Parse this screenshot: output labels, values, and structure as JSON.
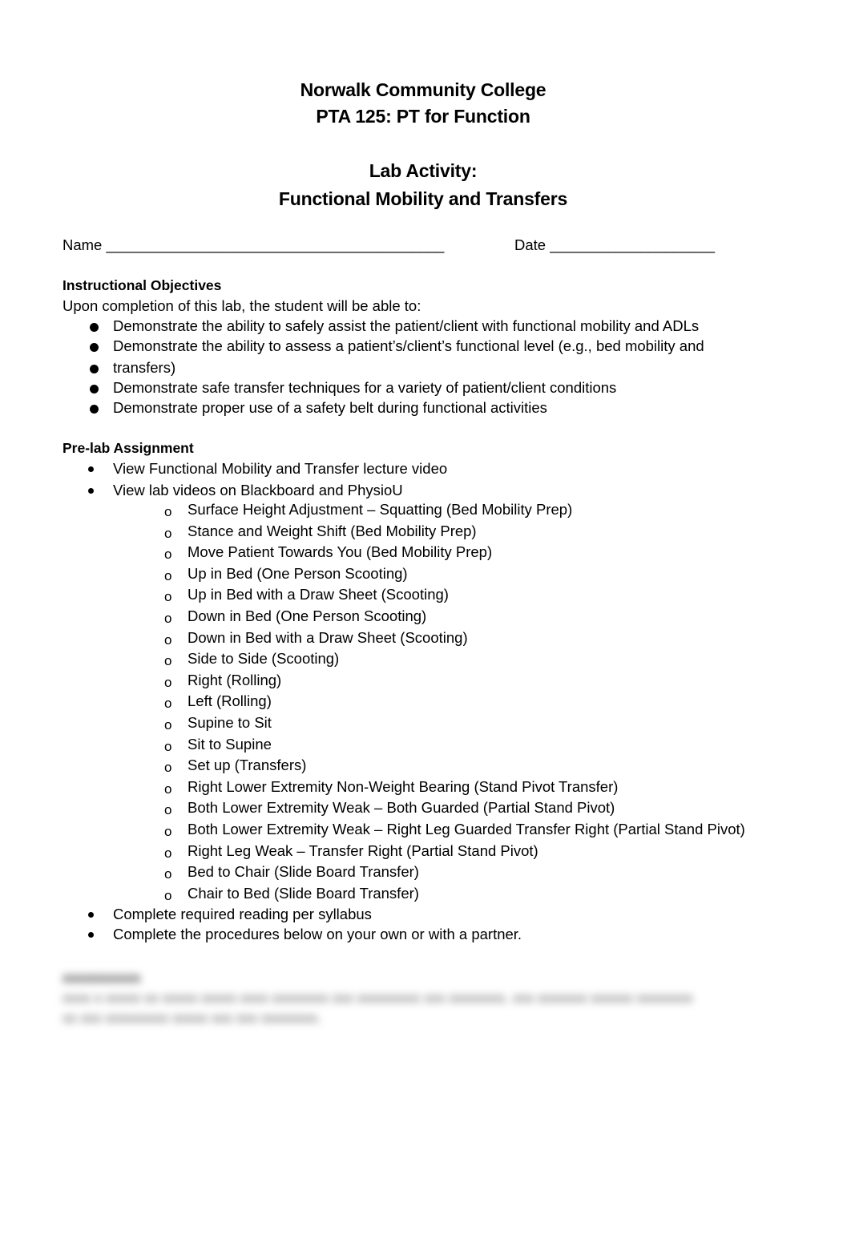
{
  "header": {
    "institution": "Norwalk Community College",
    "course": "PTA 125: PT for Function",
    "activity_label": "Lab Activity:",
    "activity_title": "Functional Mobility and Transfers"
  },
  "form": {
    "name_label": "Name _________________________________________",
    "date_label": "Date ____________________"
  },
  "objectives": {
    "heading": "Instructional Objectives",
    "intro": "Upon completion of this lab, the student will be able to:",
    "items": [
      "Demonstrate the ability to safely assist the patient/client with functional mobility and ADLs",
      "Demonstrate the ability to assess a patient’s/client’s functional level (e.g., bed mobility and",
      "transfers)",
      "Demonstrate safe transfer techniques for a variety of patient/client conditions",
      "Demonstrate proper use of a safety belt during functional activities"
    ]
  },
  "prelab": {
    "heading": "Pre-lab Assignment",
    "items": [
      "View Functional Mobility and Transfer lecture video",
      "View lab videos on Blackboard and PhysioU"
    ],
    "sub_bullet_glyph": "o",
    "videos": [
      "Surface Height Adjustment – Squatting (Bed Mobility Prep)",
      "Stance and Weight Shift (Bed Mobility Prep)",
      "Move Patient Towards You (Bed Mobility Prep)",
      "Up in Bed (One Person Scooting)",
      "Up in Bed with a Draw Sheet (Scooting)",
      "Down in Bed (One Person Scooting)",
      "Down in Bed with a Draw Sheet (Scooting)",
      "Side to Side (Scooting)",
      "Right (Rolling)",
      "Left (Rolling)",
      "Supine to Sit",
      "Sit to Supine",
      "Set up (Transfers)",
      "Right Lower Extremity Non-Weight Bearing (Stand Pivot Transfer)",
      "Both Lower Extremity Weak – Both Guarded (Partial Stand Pivot)",
      "Both Lower Extremity Weak – Right Leg Guarded Transfer Right (Partial Stand Pivot)",
      "Right Leg Weak – Transfer Right (Partial Stand Pivot)",
      "Bed to Chair (Slide Board Transfer)",
      "Chair to Bed (Slide Board Transfer)"
    ],
    "after_items": [
      "Complete required reading per syllabus",
      "Complete the procedures below on your own or with a partner."
    ]
  },
  "blurred_section": {
    "heading": "xxxxxxxxxx",
    "line1": "xxxx x xxxxx xx xxxxx  xxxxx xxxx xxxxxxxx xxx xxxxxxxxx xxx xxxxxxxx.  xxx xxxxxxx xxxxxx xxxxxxxx",
    "line2": "xx xxx xxxxxxxxx xxxxx xxx xxx xxxxxxxx."
  }
}
